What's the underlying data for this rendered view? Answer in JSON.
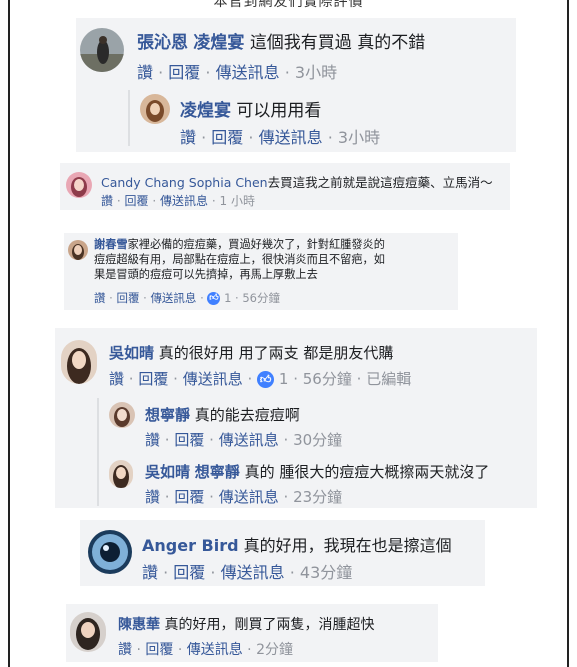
{
  "header_text": "本官到網友們實際評價",
  "labels": {
    "read": "讚",
    "reply": "回覆",
    "send": "傳送訊息",
    "edited": "已編輯",
    "dot": "·"
  },
  "comments": [
    {
      "name": "張沁恩",
      "tag": "凌煌宴",
      "text": "這個我有買過 真的不錯",
      "time": "3小時"
    },
    {
      "name": "凌煌宴",
      "text": "可以用用看",
      "time": "3小時"
    },
    {
      "name": "Candy Chang",
      "tag": "Sophia Chen",
      "text": "去買這我之前就是說這痘痘藥、立馬消～",
      "time": "1 小時"
    },
    {
      "name": "謝春雪",
      "text_lines": [
        "家裡必備的痘痘藥，買過好幾次了，針對紅腫發炎的",
        "痘痘超級有用，局部點在痘痘上，很快消炎而且不留疤，如",
        "果是冒頭的痘痘可以先擠掉，再馬上厚敷上去"
      ],
      "likes": "1",
      "time": "56分鐘"
    },
    {
      "name": "吳如晴",
      "text": "真的很好用 用了兩支 都是朋友代購",
      "likes": "1",
      "time": "56分鐘"
    },
    {
      "name": "想寧靜",
      "text": "真的能去痘痘啊",
      "time": "30分鐘"
    },
    {
      "name": "吳如晴",
      "tag": "想寧靜",
      "text": "真的 腫很大的痘痘大概擦兩天就沒了",
      "time": "23分鐘"
    },
    {
      "name": "Anger Bird",
      "text": "真的好用，我現在也是擦這個",
      "time": "43分鐘"
    },
    {
      "name": "陳惠華",
      "text": "真的好用，剛買了兩隻，消腫超快",
      "time": "2分鐘"
    }
  ],
  "colors": {
    "link": "#365899",
    "card_bg": "#f2f3f5",
    "like_blue": "#4080ff",
    "meta_gray": "#90949c"
  }
}
